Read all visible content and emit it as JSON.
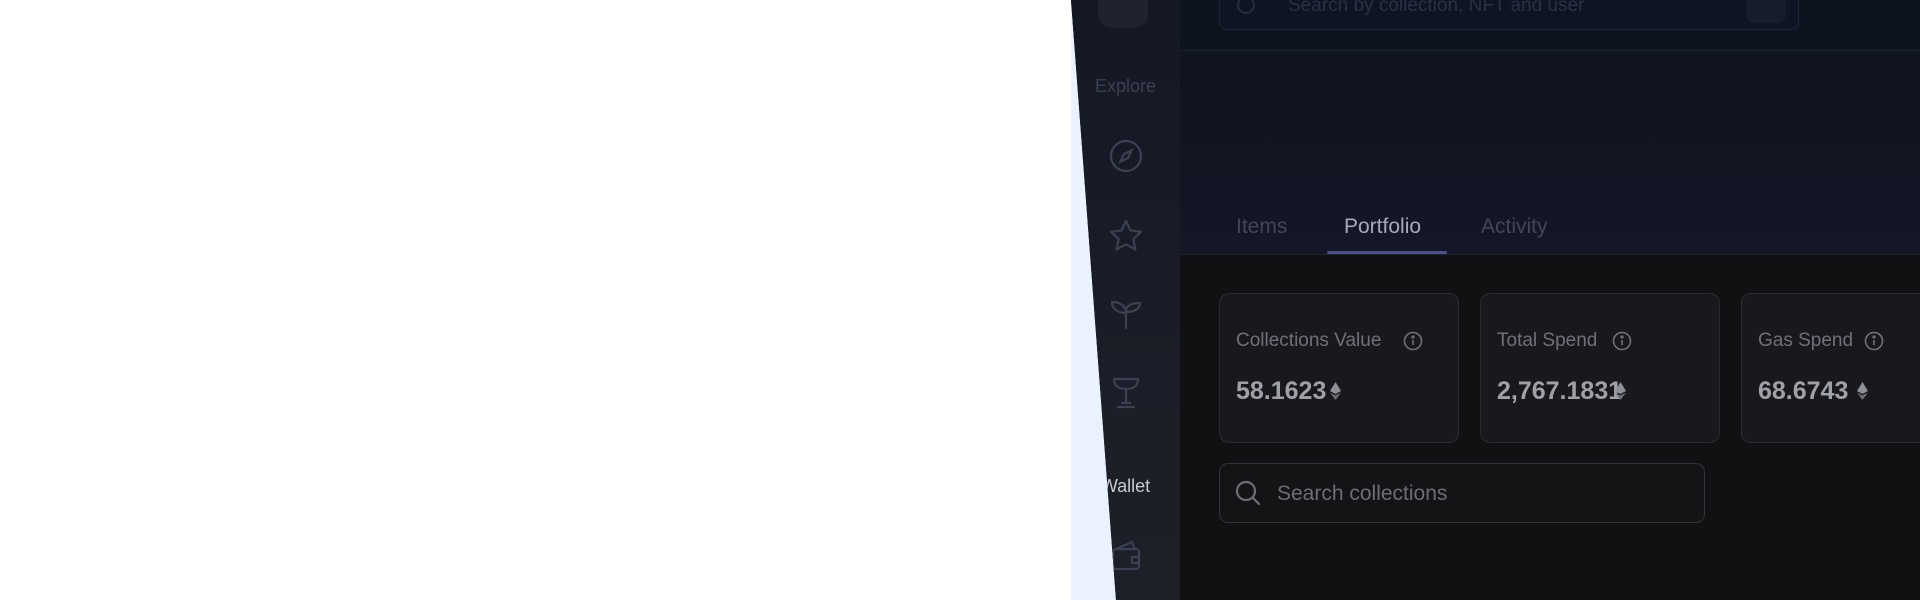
{
  "sidebar": {
    "explore_label": "Explore",
    "wallet_label": "Wallet",
    "items": [
      {
        "icon": "compass-icon"
      },
      {
        "icon": "star-icon"
      },
      {
        "icon": "sprout-icon"
      },
      {
        "icon": "trophy-icon"
      },
      {
        "icon": "wallet-icon"
      }
    ]
  },
  "topbar": {
    "search_placeholder": "Search by collection, NFT and user"
  },
  "tabs": [
    {
      "label": "Items",
      "active": false
    },
    {
      "label": "Portfolio",
      "active": true
    },
    {
      "label": "Activity",
      "active": false
    }
  ],
  "stats": [
    {
      "label": "Collections Value",
      "value": "58.1623"
    },
    {
      "label": "Total Spend",
      "value": "2,767.1831"
    },
    {
      "label": "Gas Spend",
      "value": "68.6743"
    }
  ],
  "collection_search": {
    "placeholder": "Search collections"
  },
  "colors": {
    "accent": "#4d4e8a",
    "background": "#111114",
    "sidebar": "#1a1d27",
    "wedge": "#eaf2ff"
  }
}
